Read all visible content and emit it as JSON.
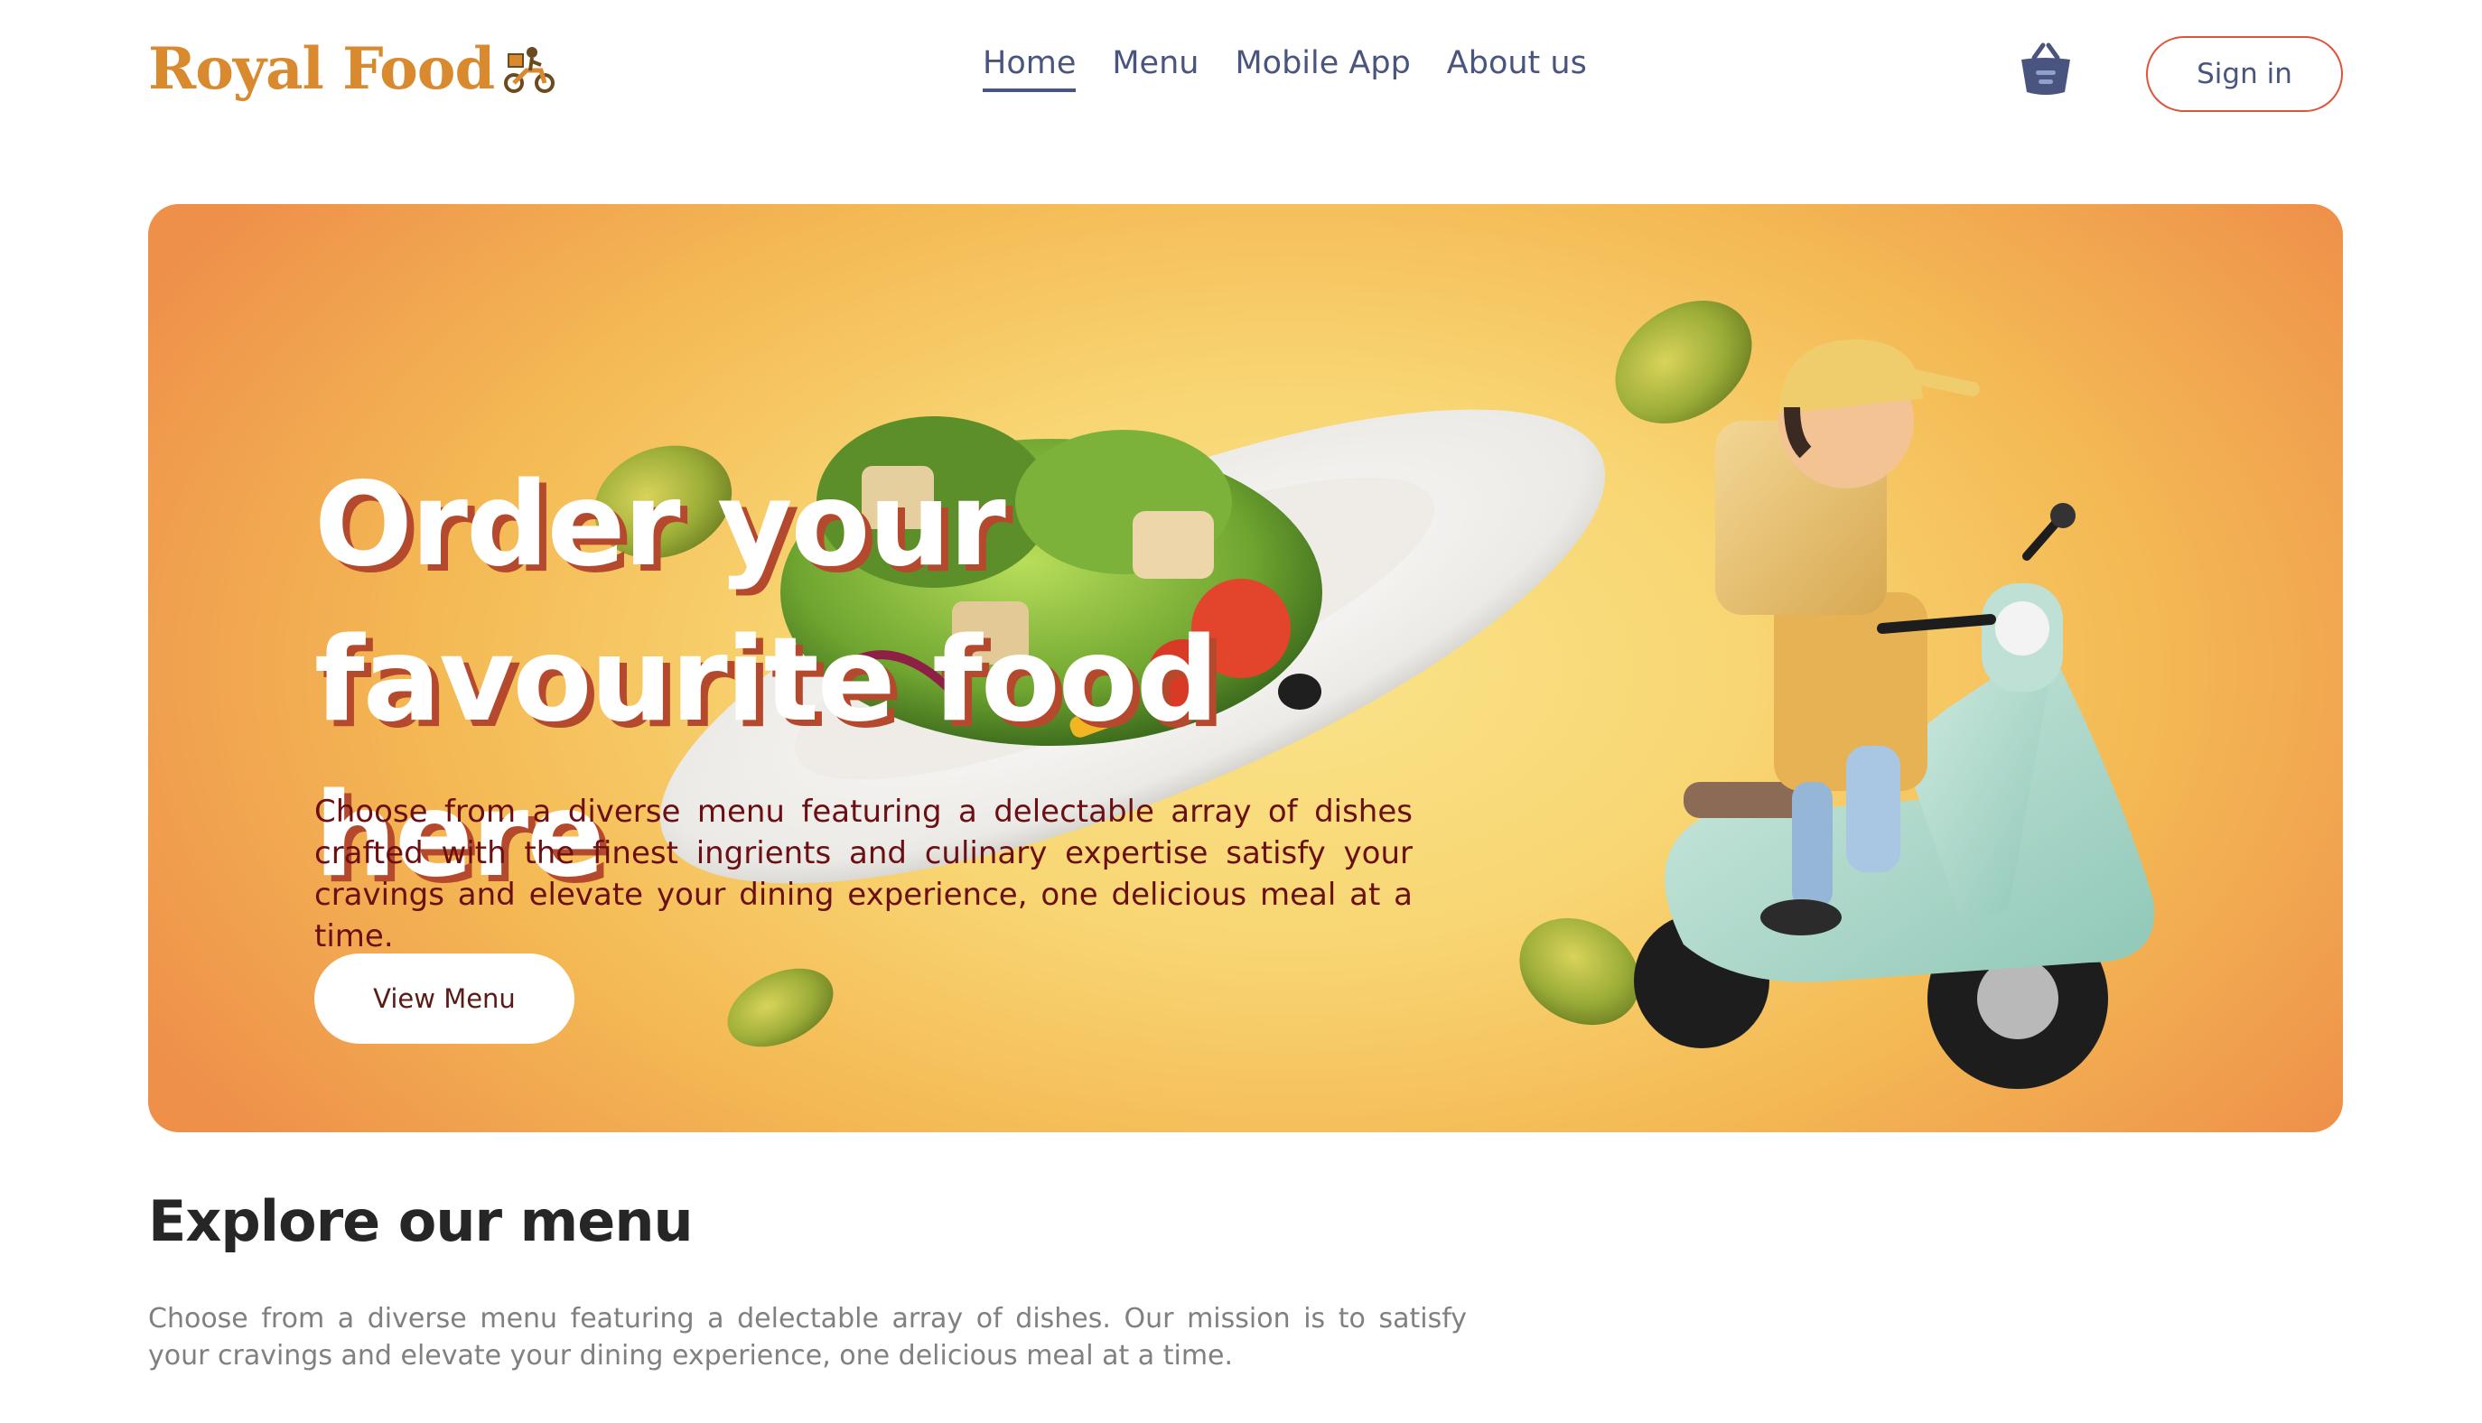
{
  "brand": {
    "name": "Royal Food",
    "logo_icon": "scooter-delivery-icon",
    "color": "#d9892e"
  },
  "nav": {
    "items": [
      {
        "label": "Home",
        "active": true
      },
      {
        "label": "Menu",
        "active": false
      },
      {
        "label": "Mobile App",
        "active": false
      },
      {
        "label": "About us",
        "active": false
      }
    ],
    "basket_icon": "basket-icon",
    "signin_label": "Sign in"
  },
  "hero": {
    "title_line1": "Order your",
    "title_line2": "favourite food here",
    "description": "Choose from a diverse menu featuring a delectable array of dishes crafted with the finest ingrients and culinary expertise satisfy your cravings and elevate your dining experience, one delicious meal at a time.",
    "cta_label": "View Menu",
    "images": [
      "salad-plate-image",
      "delivery-scooter-image",
      "lettuce-leaf-icon"
    ]
  },
  "explore": {
    "title": "Explore our menu",
    "description": "Choose from a diverse menu featuring a delectable array of dishes. Our mission is to satisfy your cravings and elevate your dining experience, one delicious meal at a time."
  },
  "colors": {
    "accent": "#e0533a",
    "nav_text": "#49557e",
    "hero_text": "#6b0f12"
  }
}
